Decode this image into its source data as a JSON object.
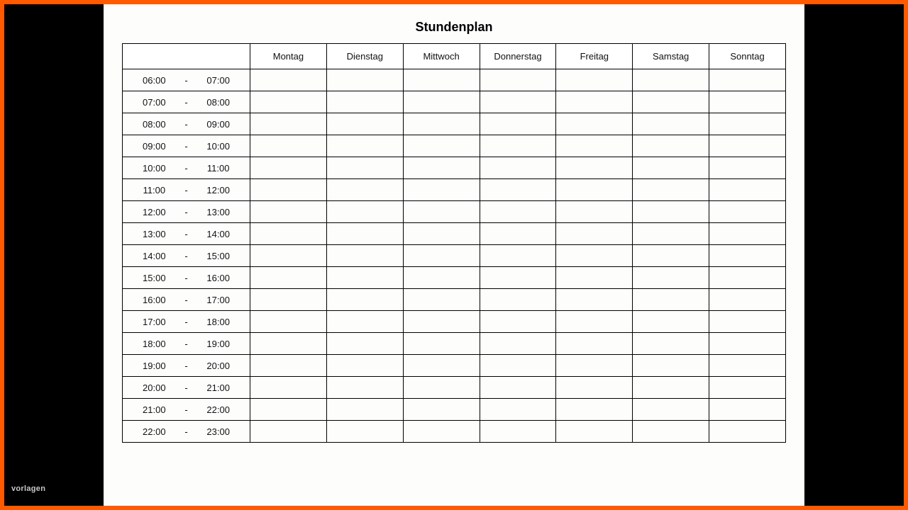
{
  "title": "Stundenplan",
  "days": [
    "Montag",
    "Dienstag",
    "Mittwoch",
    "Donnerstag",
    "Freitag",
    "Samstag",
    "Sonntag"
  ],
  "separator": "-",
  "time_slots": [
    {
      "start": "06:00",
      "end": "07:00"
    },
    {
      "start": "07:00",
      "end": "08:00"
    },
    {
      "start": "08:00",
      "end": "09:00"
    },
    {
      "start": "09:00",
      "end": "10:00"
    },
    {
      "start": "10:00",
      "end": "11:00"
    },
    {
      "start": "11:00",
      "end": "12:00"
    },
    {
      "start": "12:00",
      "end": "13:00"
    },
    {
      "start": "13:00",
      "end": "14:00"
    },
    {
      "start": "14:00",
      "end": "15:00"
    },
    {
      "start": "15:00",
      "end": "16:00"
    },
    {
      "start": "16:00",
      "end": "17:00"
    },
    {
      "start": "17:00",
      "end": "18:00"
    },
    {
      "start": "18:00",
      "end": "19:00"
    },
    {
      "start": "19:00",
      "end": "20:00"
    },
    {
      "start": "20:00",
      "end": "21:00"
    },
    {
      "start": "21:00",
      "end": "22:00"
    },
    {
      "start": "22:00",
      "end": "23:00"
    }
  ],
  "watermark": "vorlagen",
  "colors": {
    "frame": "#ff5a00",
    "page": "#fdfdfc",
    "header_shade": "#ececec"
  }
}
